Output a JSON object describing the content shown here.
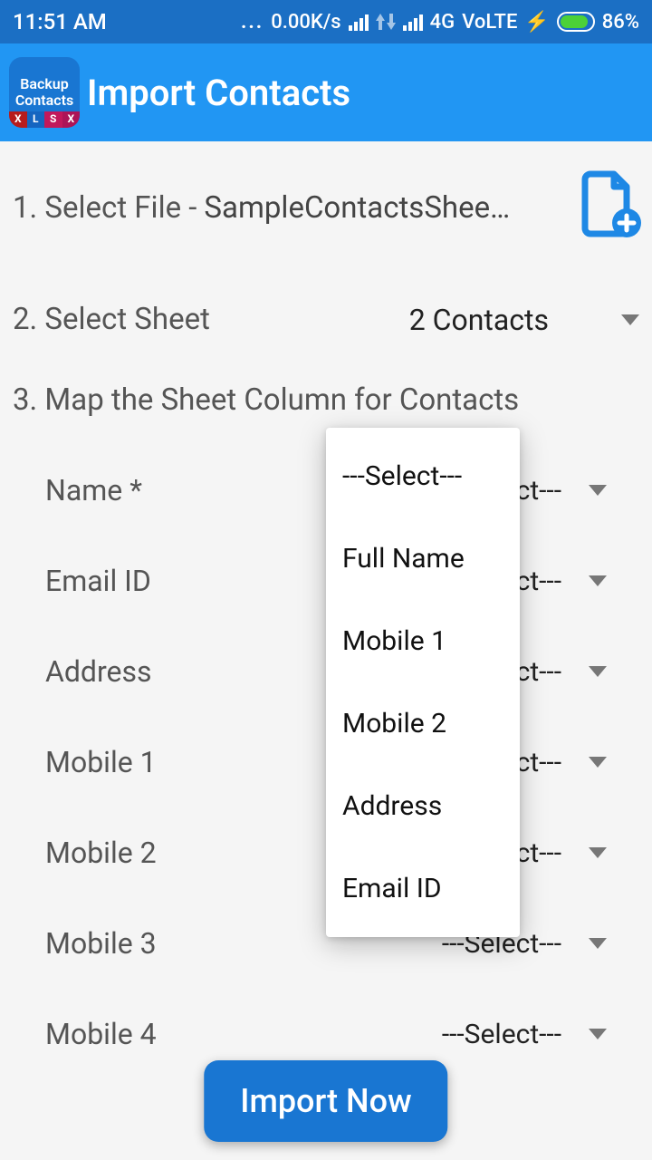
{
  "status": {
    "time": "11:51 AM",
    "speed": "0.00K/s",
    "network": "4G",
    "volte": "VoLTE",
    "battery_pct": "86%",
    "charge": "⚡"
  },
  "app": {
    "icon_line1": "Backup",
    "icon_line2": "Contacts",
    "title": "Import Contacts"
  },
  "step1": {
    "label": "1. Select File  -",
    "filename": "SampleContactsShee…"
  },
  "step2": {
    "label": "2. Select Sheet",
    "value": "2 Contacts"
  },
  "step3": {
    "label": "3. Map the Sheet Column for Contacts"
  },
  "mappings": [
    {
      "field": "Name *",
      "value": "---Select---"
    },
    {
      "field": "Email ID",
      "value": "---Select---"
    },
    {
      "field": "Address",
      "value": "---Select---"
    },
    {
      "field": "Mobile 1",
      "value": "---Select---"
    },
    {
      "field": "Mobile 2",
      "value": "---Select---"
    },
    {
      "field": "Mobile 3",
      "value": "---Select---"
    },
    {
      "field": "Mobile 4",
      "value": "---Select---"
    }
  ],
  "dropdown_options": [
    "---Select---",
    "Full Name",
    "Mobile 1",
    "Mobile 2",
    "Address",
    "Email ID"
  ],
  "buttons": {
    "import": "Import Now"
  }
}
